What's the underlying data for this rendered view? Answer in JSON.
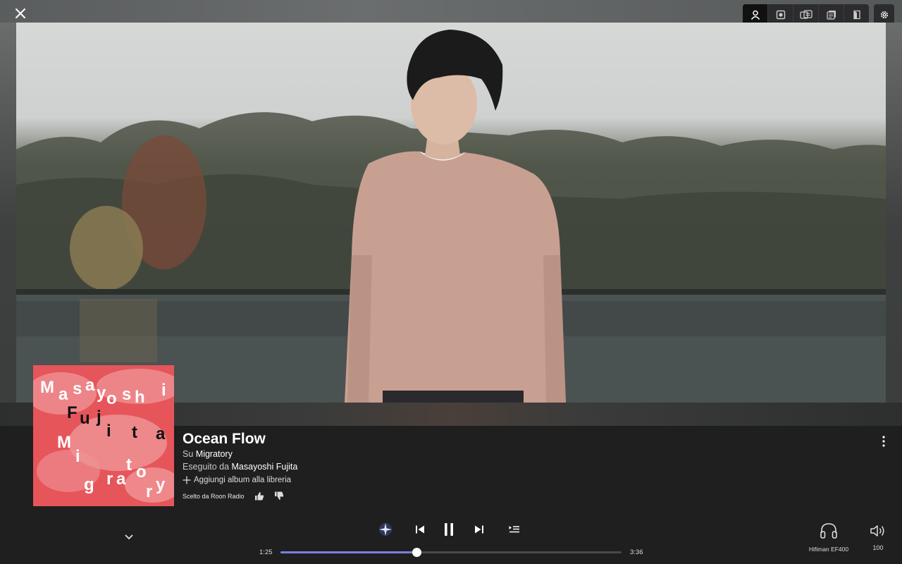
{
  "window": {
    "close_icon": "close-icon",
    "settings_icon": "gear-icon"
  },
  "view_switcher": [
    {
      "id": "artist",
      "icon": "person-icon",
      "active": true
    },
    {
      "id": "album",
      "icon": "disc-icon",
      "active": false
    },
    {
      "id": "credits",
      "icon": "cards-icon",
      "active": false
    },
    {
      "id": "lyrics",
      "icon": "stack-icon",
      "active": false
    },
    {
      "id": "info",
      "icon": "book-icon",
      "active": false
    }
  ],
  "album_art": {
    "artist_lines": [
      "M",
      "a",
      "s",
      "a",
      "y",
      "o",
      "s",
      "h",
      "i"
    ],
    "name_lines": [
      "F",
      "u",
      "j",
      "i",
      "t",
      "a"
    ],
    "album_lines": [
      "M",
      "i",
      "g",
      "r",
      "a",
      "t",
      "o",
      "r",
      "y"
    ],
    "bg_color": "#e6555a"
  },
  "now_playing": {
    "title": "Ocean Flow",
    "album_prefix": "Su",
    "album": "Migratory",
    "artist_prefix": "Eseguito da",
    "artist": "Masayoshi Fujita",
    "add_to_library": "Aggiungi album alla libreria",
    "radio_source": "Scelto da Roon Radio"
  },
  "transport": {
    "elapsed": "1:25",
    "duration": "3:36",
    "progress": 0.398
  },
  "zone": {
    "name": "Hifiman EF400",
    "volume": "100"
  },
  "colors": {
    "accent": "#7b7fe0",
    "panel": "#1f1f20"
  }
}
